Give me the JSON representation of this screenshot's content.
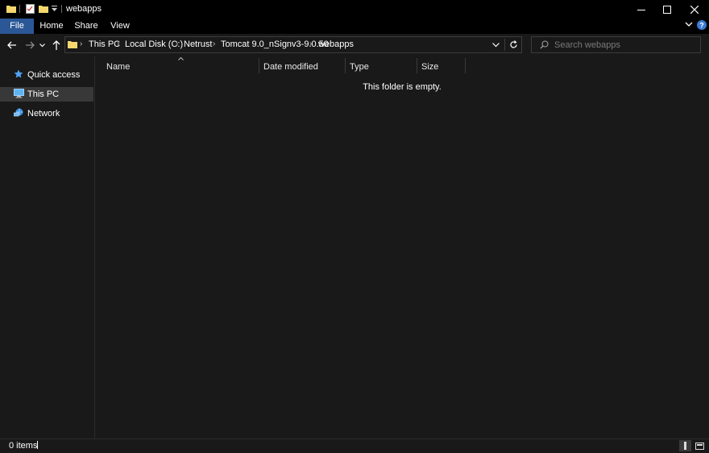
{
  "window": {
    "title": "webapps",
    "controls": [
      "minimize",
      "maximize",
      "close"
    ]
  },
  "ribbon": {
    "tabs": [
      {
        "label": "File",
        "active": true
      },
      {
        "label": "Home"
      },
      {
        "label": "Share"
      },
      {
        "label": "View"
      }
    ]
  },
  "address": {
    "breadcrumbs": [
      "This PC",
      "Local Disk (C:)",
      "Netrust",
      "Tomcat 9.0_nSignv3-9.0.50",
      "webapps"
    ]
  },
  "search": {
    "placeholder": "Search webapps",
    "value": ""
  },
  "nav": {
    "items": [
      {
        "label": "Quick access",
        "icon": "star-icon"
      },
      {
        "label": "This PC",
        "icon": "computer-icon",
        "selected": true
      },
      {
        "label": "Network",
        "icon": "network-icon"
      }
    ]
  },
  "content": {
    "columns": [
      "Name",
      "Date modified",
      "Type",
      "Size"
    ],
    "sort_column": "Name",
    "empty_message": "This folder is empty."
  },
  "status": {
    "item_count": "0 items"
  },
  "colors": {
    "background": "#191919",
    "titlebar": "#000000",
    "file_tab": "#2b5797",
    "selected_nav": "#383838",
    "help_icon": "#3a7bd5",
    "folder": "#f5d76e"
  }
}
